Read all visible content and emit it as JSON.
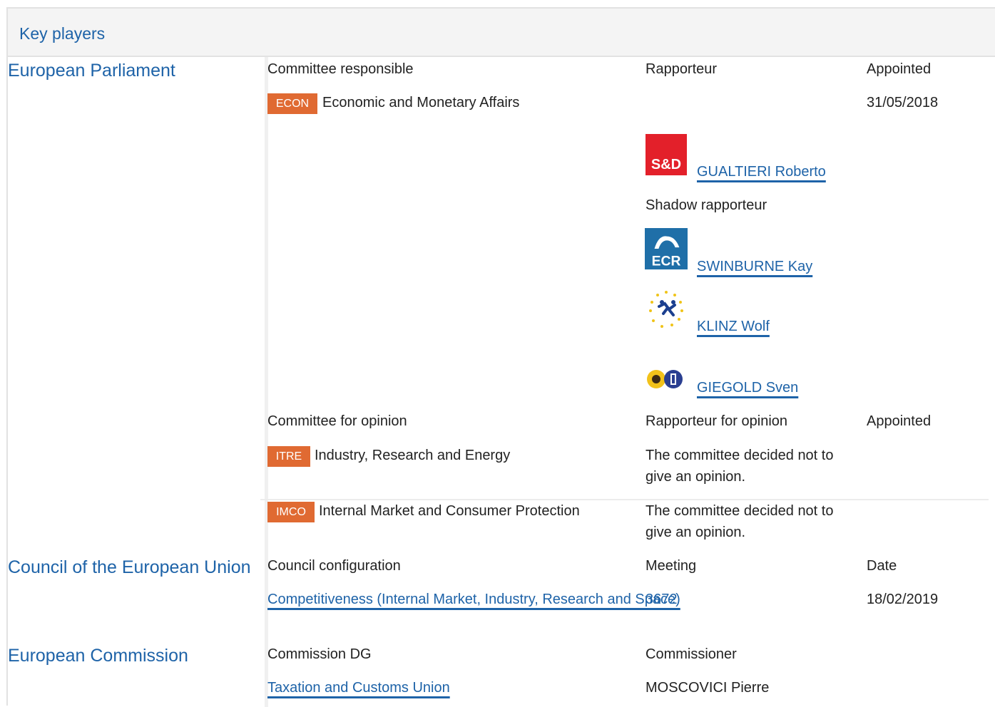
{
  "panel": {
    "title": "Key players"
  },
  "parliament": {
    "label": "European Parliament",
    "responsible": {
      "col_committee": "Committee responsible",
      "col_rapporteur": "Rapporteur",
      "col_appointed": "Appointed",
      "committee_code": "ECON",
      "committee_name": "Economic and Monetary Affairs",
      "appointed_date": "31/05/2018",
      "rapporteur": {
        "group_logo": "S&D",
        "name": "GUALTIERI Roberto"
      },
      "shadow_label": "Shadow rapporteur",
      "shadows": [
        {
          "group_logo": "ECR",
          "name": "SWINBURNE Kay"
        },
        {
          "group_logo": "ALDE",
          "name": "KLINZ Wolf"
        },
        {
          "group_logo": "Greens/EFA",
          "name": "GIEGOLD Sven"
        }
      ]
    },
    "opinion": {
      "col_committee": "Committee for opinion",
      "col_rapporteur": "Rapporteur for opinion",
      "col_appointed": "Appointed",
      "committees": [
        {
          "code": "ITRE",
          "name": "Industry, Research and Energy",
          "note": "The committee decided not to give an opinion."
        },
        {
          "code": "IMCO",
          "name": "Internal Market and Consumer Protection",
          "note": "The committee decided not to give an opinion."
        }
      ]
    }
  },
  "council": {
    "label": "Council of the European Union",
    "col_configuration": "Council configuration",
    "col_meeting": "Meeting",
    "col_date": "Date",
    "configuration": "Competitiveness (Internal Market, Industry, Research and Space)",
    "meeting": "3672",
    "date": "18/02/2019"
  },
  "commission": {
    "label": "European Commission",
    "col_dg": "Commission DG",
    "col_commissioner": "Commissioner",
    "dg": "Taxation and Customs Union",
    "commissioner": "MOSCOVICI Pierre"
  },
  "colors": {
    "link": "#1e63a8",
    "badge": "#e06a32"
  }
}
